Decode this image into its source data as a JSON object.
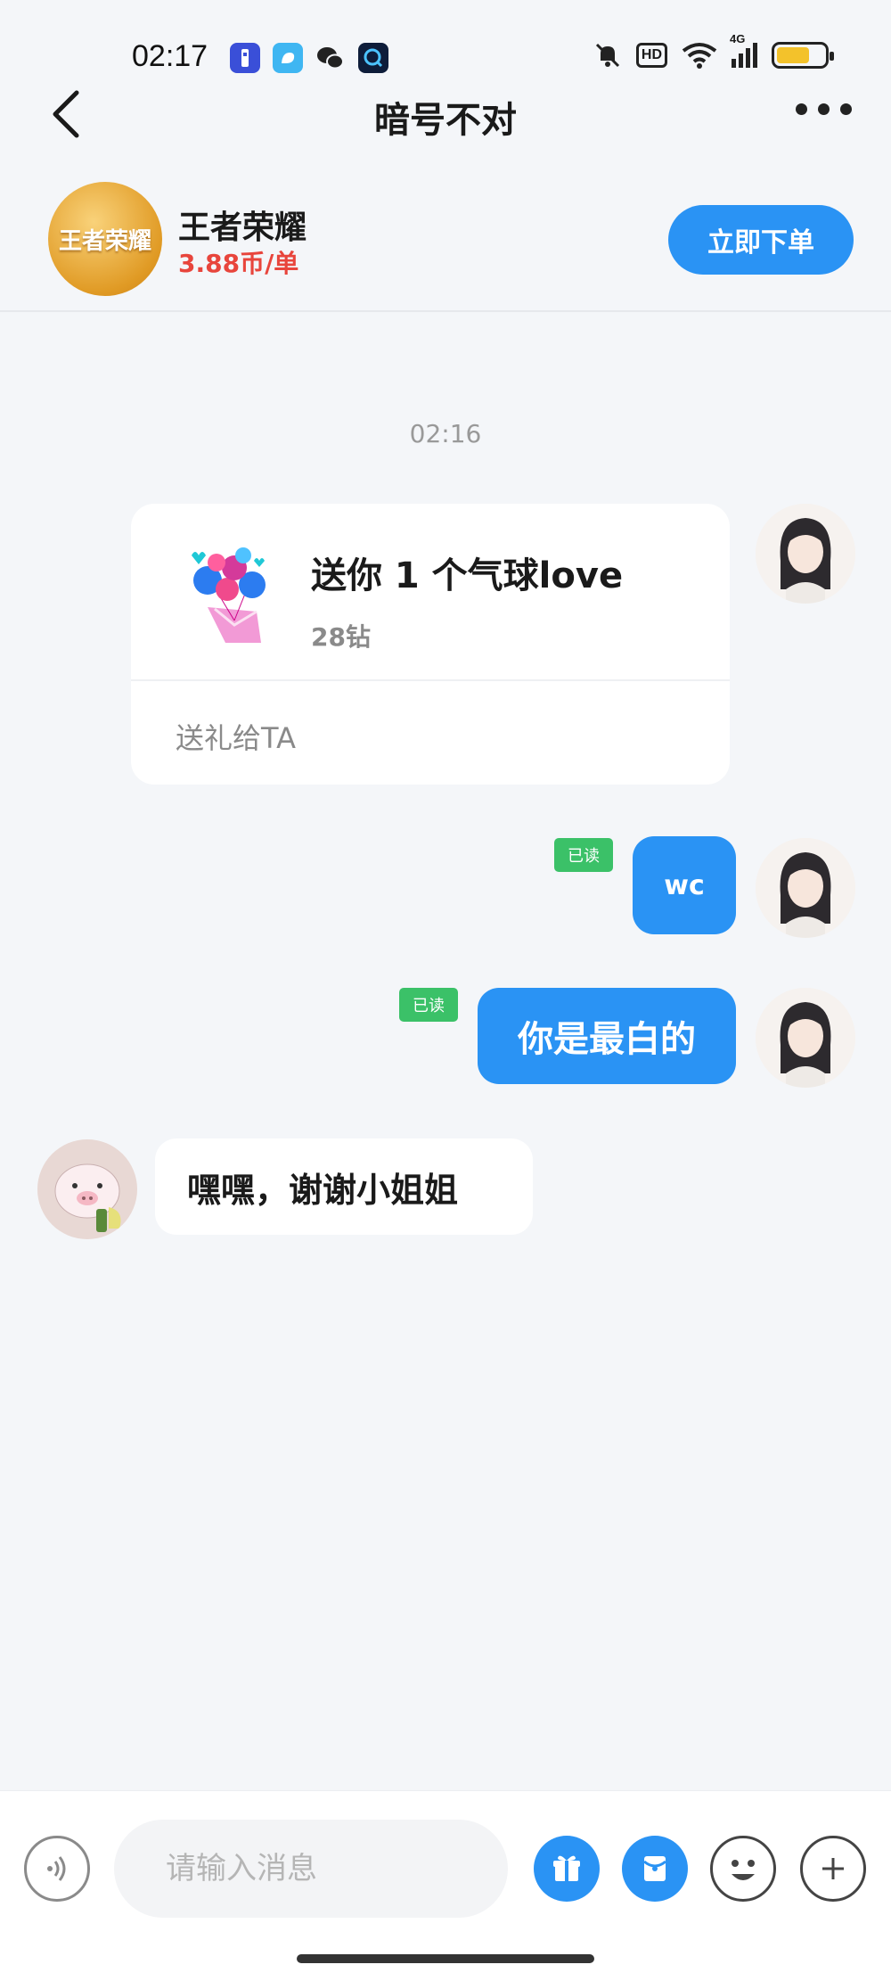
{
  "status_bar": {
    "time": "02:17",
    "network": "4G",
    "hd_label": "HD",
    "apps": [
      "flashlight-app-icon",
      "bird-app-icon",
      "wechat-icon",
      "qq-browser-icon"
    ]
  },
  "nav": {
    "title": "暗号不对"
  },
  "game_card": {
    "logo_text": "王者荣耀",
    "name": "王者荣耀",
    "price": "3.88币/单",
    "order_button": "立即下单"
  },
  "chat": {
    "timestamp": "02:16",
    "gift": {
      "title": "送你 1 个气球love",
      "price": "28钻",
      "action": "送礼给TA"
    },
    "messages": [
      {
        "side": "right",
        "text": "wc",
        "read_tag": "已读"
      },
      {
        "side": "right",
        "text": "你是最白的",
        "read_tag": "已读"
      },
      {
        "side": "left",
        "text": "嘿嘿，谢谢小姐姐"
      }
    ]
  },
  "input_bar": {
    "placeholder": "请输入消息"
  },
  "colors": {
    "accent": "#2a93f4",
    "read_tag": "#3bc168",
    "price": "#e8453c",
    "background": "#f4f6f9"
  }
}
